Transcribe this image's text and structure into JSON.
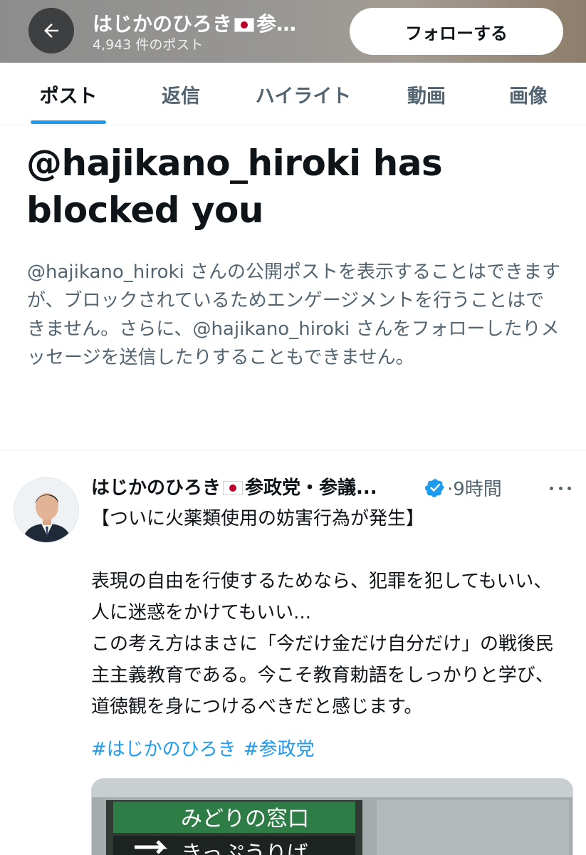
{
  "header": {
    "title_prefix": "はじかのひろき",
    "title_suffix": "参…",
    "post_count": "4,943 件のポスト",
    "follow_label": "フォローする"
  },
  "tabs": [
    {
      "label": "ポスト",
      "active": true
    },
    {
      "label": "返信"
    },
    {
      "label": "ハイライト"
    },
    {
      "label": "動画"
    },
    {
      "label": "画像"
    }
  ],
  "blocked": {
    "title": "@hajikano_hiroki has blocked you",
    "description": "@hajikano_hiroki さんの公開ポストを表示することはできますが、ブロックされているためエンゲージメントを行うことはできません。さらに、@hajikano_hiroki さんをフォローしたりメッセージを送信したりすることもできません。"
  },
  "post": {
    "author_prefix": "はじかのひろき",
    "author_suffix": "参政党・参議...",
    "separator": "·",
    "time": "9時間",
    "lines": [
      "【ついに火薬類使用の妨害行為が発生】",
      "",
      "表現の自由を行使するためなら、犯罪を犯してもいい、人に迷惑をかけてもいい...",
      "この考え方はまさに「今だけ金だけ自分だけ」の戦後民主主義教育である。今こそ教育勅語をしっかりと学び、道徳観を身につけるべきだと感じます。"
    ],
    "hashtags": [
      "#はじかのひろき",
      "#参政党"
    ],
    "media_sign_top": "みどりの窓口",
    "media_sign_bottom": "きっぷうりば"
  },
  "colors": {
    "accent": "#1d9bf0",
    "secondary_text": "#536471",
    "primary_text": "#0f1419",
    "verified": "#1d9bf0",
    "flag_red": "#bc002d"
  },
  "icons": {
    "back": "arrow-left-icon",
    "verified": "verified-badge-icon",
    "more": "more-horizontal-icon",
    "flag": "japan-flag-icon"
  }
}
